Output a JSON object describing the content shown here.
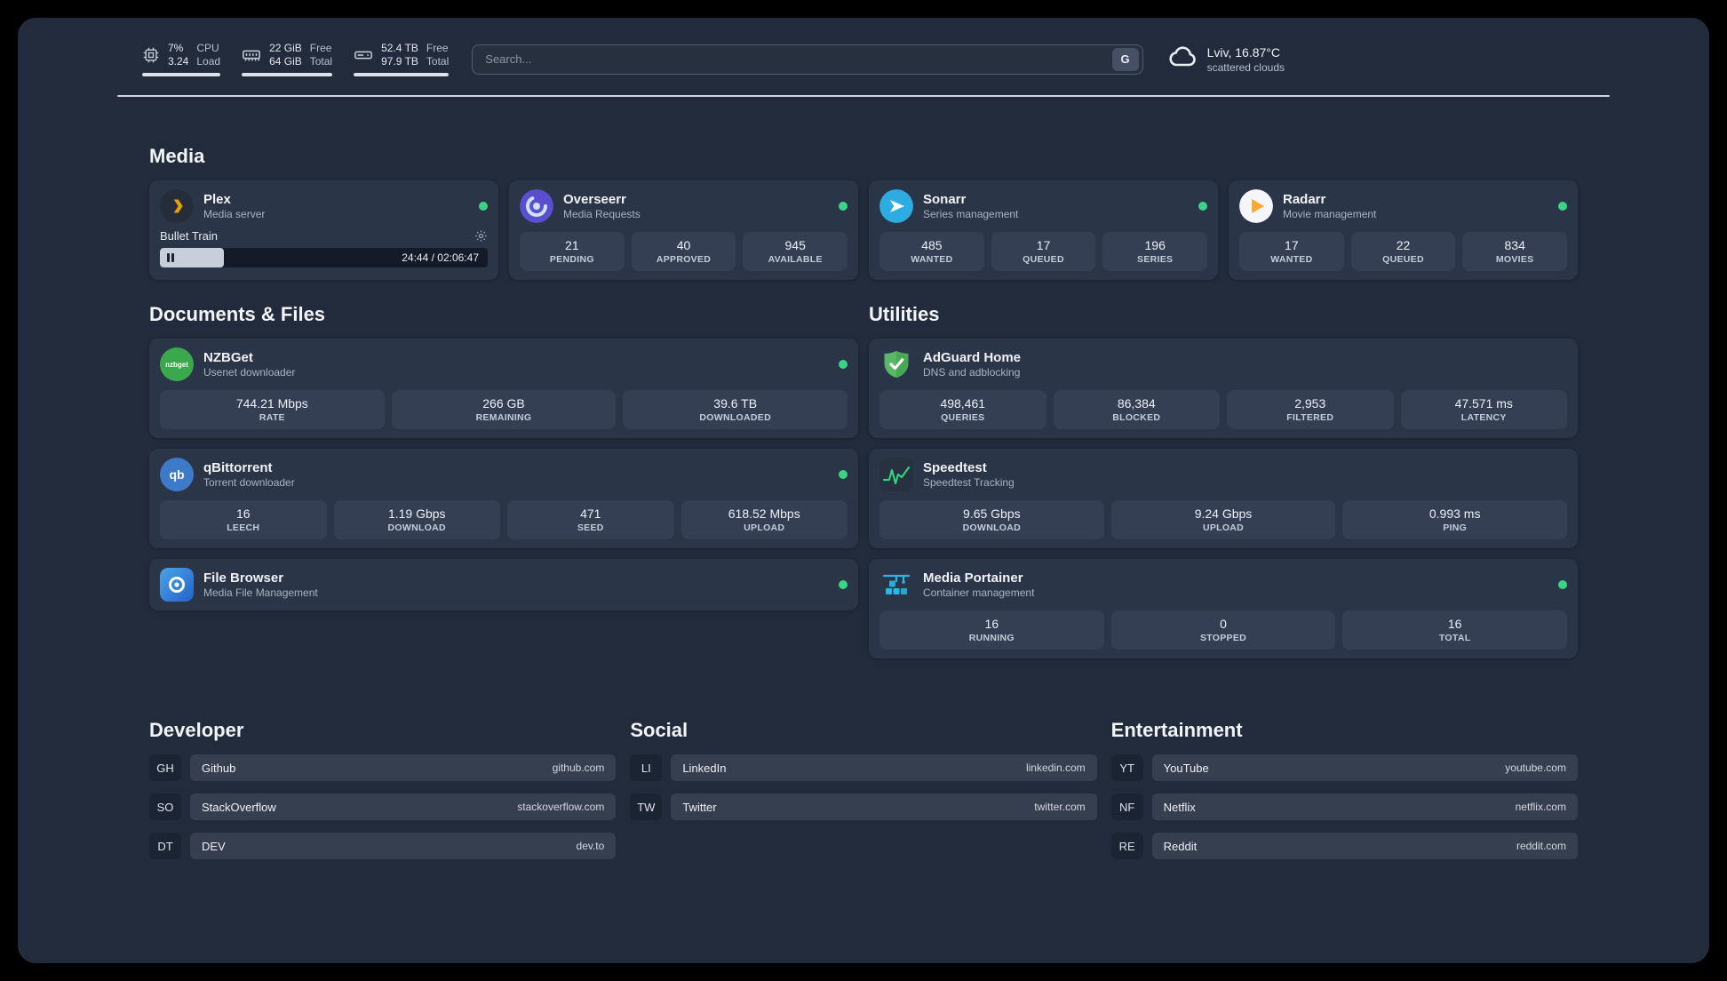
{
  "topbar": {
    "cpu": {
      "percent": "7%",
      "load": "3.24",
      "label1": "CPU",
      "label2": "Load",
      "bar_percent": 100
    },
    "memory": {
      "free": "22 GiB",
      "total": "64 GiB",
      "label1": "Free",
      "label2": "Total",
      "bar_percent": 100
    },
    "storage": {
      "free": "52.4 TB",
      "total": "97.9 TB",
      "label1": "Free",
      "label2": "Total",
      "bar_percent": 100
    },
    "search": {
      "placeholder": "Search...",
      "engine": "G"
    },
    "weather": {
      "location": "Lviv, 16.87°C",
      "condition": "scattered clouds"
    }
  },
  "sections": {
    "media": "Media",
    "documents": "Documents & Files",
    "utilities": "Utilities",
    "developer": "Developer",
    "social": "Social",
    "entertainment": "Entertainment"
  },
  "apps": {
    "plex": {
      "name": "Plex",
      "desc": "Media server",
      "track": "Bullet Train",
      "time": "24:44 / 02:06:47",
      "progress_percent": 19.5
    },
    "overseerr": {
      "name": "Overseerr",
      "desc": "Media Requests",
      "stats": [
        {
          "value": "21",
          "label": "PENDING"
        },
        {
          "value": "40",
          "label": "APPROVED"
        },
        {
          "value": "945",
          "label": "AVAILABLE"
        }
      ]
    },
    "sonarr": {
      "name": "Sonarr",
      "desc": "Series management",
      "stats": [
        {
          "value": "485",
          "label": "WANTED"
        },
        {
          "value": "17",
          "label": "QUEUED"
        },
        {
          "value": "196",
          "label": "SERIES"
        }
      ]
    },
    "radarr": {
      "name": "Radarr",
      "desc": "Movie management",
      "stats": [
        {
          "value": "17",
          "label": "WANTED"
        },
        {
          "value": "22",
          "label": "QUEUED"
        },
        {
          "value": "834",
          "label": "MOVIES"
        }
      ]
    },
    "nzbget": {
      "name": "NZBGet",
      "desc": "Usenet downloader",
      "icon_text": "nzbget",
      "stats": [
        {
          "value": "744.21 Mbps",
          "label": "RATE"
        },
        {
          "value": "266 GB",
          "label": "REMAINING"
        },
        {
          "value": "39.6 TB",
          "label": "DOWNLOADED"
        }
      ]
    },
    "qbittorrent": {
      "name": "qBittorrent",
      "desc": "Torrent downloader",
      "icon_text": "qb",
      "stats": [
        {
          "value": "16",
          "label": "LEECH"
        },
        {
          "value": "1.19 Gbps",
          "label": "DOWNLOAD"
        },
        {
          "value": "471",
          "label": "SEED"
        },
        {
          "value": "618.52 Mbps",
          "label": "UPLOAD"
        }
      ]
    },
    "filebrowser": {
      "name": "File Browser",
      "desc": "Media File Management"
    },
    "adguard": {
      "name": "AdGuard Home",
      "desc": "DNS and adblocking",
      "stats": [
        {
          "value": "498,461",
          "label": "QUERIES"
        },
        {
          "value": "86,384",
          "label": "BLOCKED"
        },
        {
          "value": "2,953",
          "label": "FILTERED"
        },
        {
          "value": "47.571 ms",
          "label": "LATENCY"
        }
      ]
    },
    "speedtest": {
      "name": "Speedtest",
      "desc": "Speedtest Tracking",
      "stats": [
        {
          "value": "9.65 Gbps",
          "label": "DOWNLOAD"
        },
        {
          "value": "9.24 Gbps",
          "label": "UPLOAD"
        },
        {
          "value": "0.993 ms",
          "label": "PING"
        }
      ]
    },
    "portainer": {
      "name": "Media Portainer",
      "desc": "Container management",
      "stats": [
        {
          "value": "16",
          "label": "RUNNING"
        },
        {
          "value": "0",
          "label": "STOPPED"
        },
        {
          "value": "16",
          "label": "TOTAL"
        }
      ]
    }
  },
  "bookmarks": {
    "developer": [
      {
        "abbr": "GH",
        "name": "Github",
        "url": "github.com"
      },
      {
        "abbr": "SO",
        "name": "StackOverflow",
        "url": "stackoverflow.com"
      },
      {
        "abbr": "DT",
        "name": "DEV",
        "url": "dev.to"
      }
    ],
    "social": [
      {
        "abbr": "LI",
        "name": "LinkedIn",
        "url": "linkedin.com"
      },
      {
        "abbr": "TW",
        "name": "Twitter",
        "url": "twitter.com"
      }
    ],
    "entertainment": [
      {
        "abbr": "YT",
        "name": "YouTube",
        "url": "youtube.com"
      },
      {
        "abbr": "NF",
        "name": "Netflix",
        "url": "netflix.com"
      },
      {
        "abbr": "RE",
        "name": "Reddit",
        "url": "reddit.com"
      }
    ]
  }
}
